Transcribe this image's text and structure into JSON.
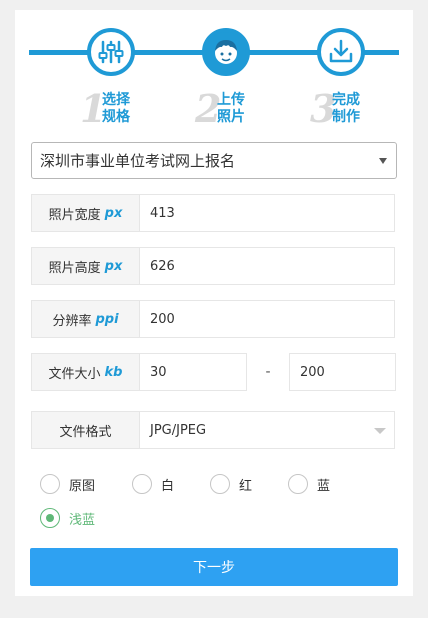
{
  "steps": [
    {
      "number": "1",
      "label": "选择规格",
      "icon": "sliders-icon"
    },
    {
      "number": "2",
      "label": "上传照片",
      "icon": "avatar-icon"
    },
    {
      "number": "3",
      "label": "完成制作",
      "icon": "download-icon"
    }
  ],
  "colors": {
    "accent": "#1f9ad6",
    "button": "#2ea1f2",
    "radio_checked": "#5fb878"
  },
  "school_select": {
    "value": "深圳市事业单位考试网上报名"
  },
  "fields": {
    "width": {
      "label": "照片宽度",
      "unit": "px",
      "value": "413"
    },
    "height": {
      "label": "照片高度",
      "unit": "px",
      "value": "626"
    },
    "resolution": {
      "label": "分辨率",
      "unit": "ppi",
      "value": "200"
    },
    "filesize": {
      "label": "文件大小",
      "unit": "kb",
      "min": "30",
      "separator": "-",
      "max": "200"
    },
    "format": {
      "label": "文件格式",
      "value": "JPG/JPEG"
    }
  },
  "background_options": [
    {
      "label": "原图",
      "checked": false
    },
    {
      "label": "白",
      "checked": false
    },
    {
      "label": "红",
      "checked": false
    },
    {
      "label": "蓝",
      "checked": false
    },
    {
      "label": "浅蓝",
      "checked": true
    }
  ],
  "next_button": {
    "label": "下一步"
  }
}
